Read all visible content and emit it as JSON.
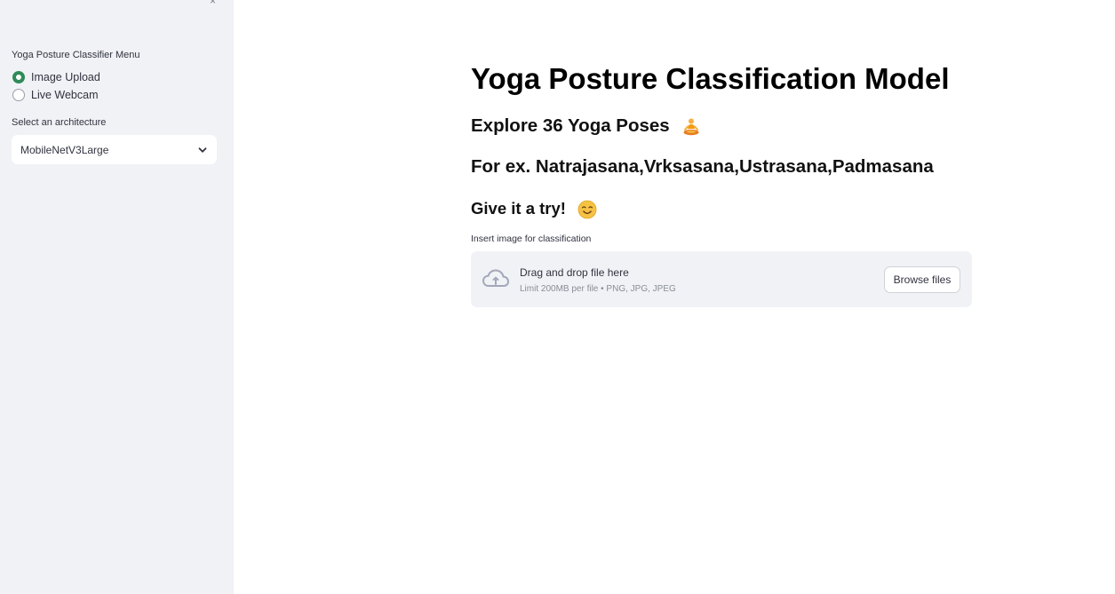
{
  "sidebar": {
    "close_glyph": "×",
    "menu_title": "Yoga Posture Classifier Menu",
    "radio_options": [
      {
        "label": "Image Upload",
        "selected": true
      },
      {
        "label": "Live Webcam",
        "selected": false
      }
    ],
    "architecture_label": "Select an architecture",
    "architecture_value": "MobileNetV3Large"
  },
  "main": {
    "title": "Yoga Posture Classification Model",
    "explore_heading": "Explore 36 Yoga Poses",
    "examples_heading": "For ex. Natrajasana,Vrksasana,Ustrasana,Padmasana",
    "try_heading": "Give it a try!",
    "upload_label": "Insert image for classification",
    "dropzone": {
      "main_text": "Drag and drop file here",
      "limit_text": "Limit 200MB per file • PNG, JPG, JPEG",
      "browse_label": "Browse files"
    }
  },
  "icons": [
    "close-icon",
    "chevron-down-icon",
    "meditation-emoji-icon",
    "smile-emoji-icon",
    "cloud-upload-icon"
  ],
  "colors": {
    "accent": "#2e8b57",
    "sidebar_bg": "#f0f2f6",
    "dropzone_bg": "#f0f2f6"
  }
}
